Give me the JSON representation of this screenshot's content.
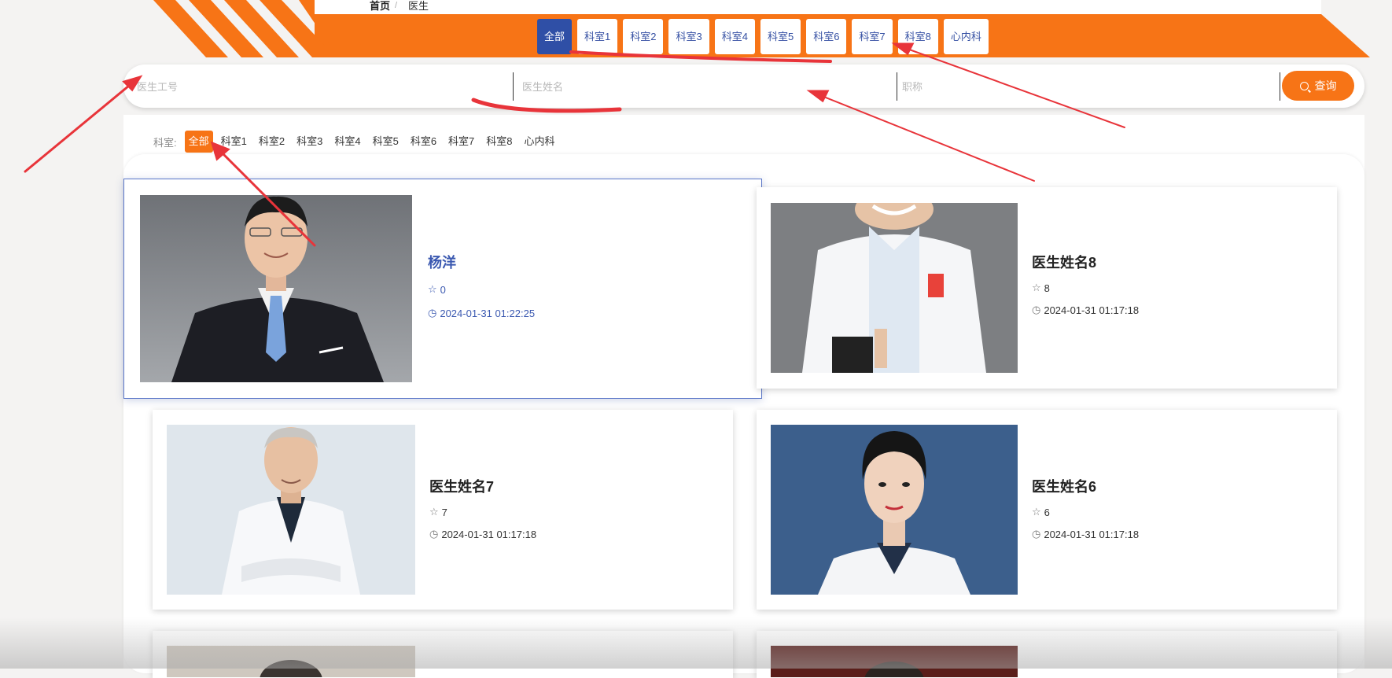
{
  "breadcrumb": {
    "home": "首页",
    "separator": "/",
    "current": "医生"
  },
  "top_tabs": [
    "全部",
    "科室1",
    "科室2",
    "科室3",
    "科室4",
    "科室5",
    "科室6",
    "科室7",
    "科室8",
    "心内科"
  ],
  "search": {
    "id_placeholder": "医生工号",
    "name_placeholder": "医生姓名",
    "title_placeholder": "职称",
    "button_label": "查询"
  },
  "filter": {
    "label": "科室:",
    "items": [
      "全部",
      "科室1",
      "科室2",
      "科室3",
      "科室4",
      "科室5",
      "科室6",
      "科室7",
      "科室8",
      "心内科"
    ]
  },
  "doctors": [
    {
      "name": "杨洋",
      "favorites": "0",
      "time": "2024-01-31 01:22:25"
    },
    {
      "name": "医生姓名8",
      "favorites": "8",
      "time": "2024-01-31 01:17:18"
    },
    {
      "name": "医生姓名7",
      "favorites": "7",
      "time": "2024-01-31 01:17:18"
    },
    {
      "name": "医生姓名6",
      "favorites": "6",
      "time": "2024-01-31 01:17:18"
    }
  ],
  "colors": {
    "accent": "#f77416",
    "primary": "#2f4fa6",
    "annotation": "#e8343a"
  }
}
